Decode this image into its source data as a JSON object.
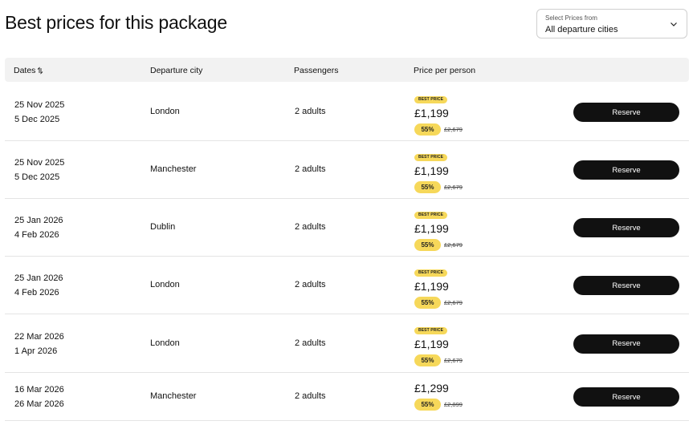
{
  "header": {
    "title": "Best prices for this package",
    "select": {
      "caption": "Select Prices from",
      "value": "All departure cities"
    }
  },
  "table": {
    "columns": [
      "Dates",
      "Departure city",
      "Passengers",
      "Price per person"
    ],
    "best_price_label": "BEST PRICE",
    "reserve_label": "Reserve",
    "rows": [
      {
        "date_from": "25 Nov 2025",
        "date_to": "5 Dec 2025",
        "city": "London",
        "passengers": "2 adults",
        "best_price": true,
        "price": "£1,199",
        "discount": "55%",
        "old_price": "£2,679"
      },
      {
        "date_from": "25 Nov 2025",
        "date_to": "5 Dec 2025",
        "city": "Manchester",
        "passengers": "2 adults",
        "best_price": true,
        "price": "£1,199",
        "discount": "55%",
        "old_price": "£2,679"
      },
      {
        "date_from": "25 Jan 2026",
        "date_to": "4 Feb 2026",
        "city": "Dublin",
        "passengers": "2 adults",
        "best_price": true,
        "price": "£1,199",
        "discount": "55%",
        "old_price": "£2,679"
      },
      {
        "date_from": "25 Jan 2026",
        "date_to": "4 Feb 2026",
        "city": "London",
        "passengers": "2 adults",
        "best_price": true,
        "price": "£1,199",
        "discount": "55%",
        "old_price": "£2,679"
      },
      {
        "date_from": "22 Mar 2026",
        "date_to": "1 Apr 2026",
        "city": "London",
        "passengers": "2 adults",
        "best_price": true,
        "price": "£1,199",
        "discount": "55%",
        "old_price": "£2,679"
      },
      {
        "date_from": "16 Mar 2026",
        "date_to": "26 Mar 2026",
        "city": "Manchester",
        "passengers": "2 adults",
        "best_price": false,
        "price": "£1,299",
        "discount": "55%",
        "old_price": "£2,899"
      }
    ]
  },
  "colors": {
    "badge": "#f6d85a",
    "button": "#111111",
    "header_bg": "#f2f2f2"
  }
}
